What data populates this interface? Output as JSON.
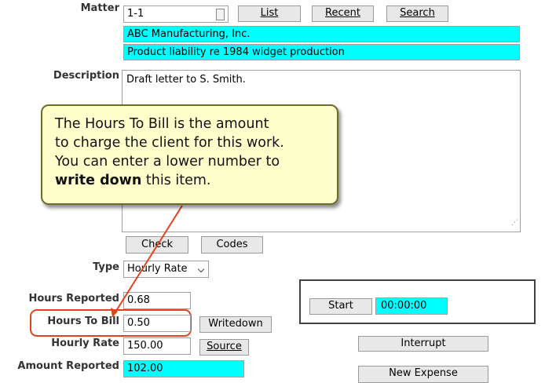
{
  "matter": {
    "label": "Matter",
    "value": "1-1",
    "list_label": "List",
    "recent_label": "Recent",
    "search_label": "Search",
    "client_name": "ABC Manufacturing, Inc.",
    "matter_description": "Product liability re 1984 widget production"
  },
  "description": {
    "label": "Description",
    "value": "Draft letter to S. Smith."
  },
  "check_label": "Check",
  "codes_label": "Codes",
  "type": {
    "label": "Type",
    "value": "Hourly Rate"
  },
  "hours_reported": {
    "label": "Hours Reported",
    "value": "0.68"
  },
  "hours_to_bill": {
    "label": "Hours To Bill",
    "value": "0.50",
    "writedown_label": "Writedown"
  },
  "hourly_rate": {
    "label": "Hourly Rate",
    "value": "150.00",
    "source_label": "Source"
  },
  "amount_reported": {
    "label": "Amount Reported",
    "value": "102.00"
  },
  "timer": {
    "start_label": "Start",
    "value": "00:00:00",
    "interrupt_label": "Interrupt"
  },
  "new_expense_label": "New Expense",
  "callout": {
    "line1": "The Hours To Bill is the amount",
    "line2": "to charge the client for this work.",
    "line3": "You can enter a lower number to",
    "bold": "write down",
    "tail": " this item."
  },
  "colors": {
    "highlight": "#00ffff",
    "callout_bg": "#ffffcc",
    "arrow": "#e3421f"
  }
}
